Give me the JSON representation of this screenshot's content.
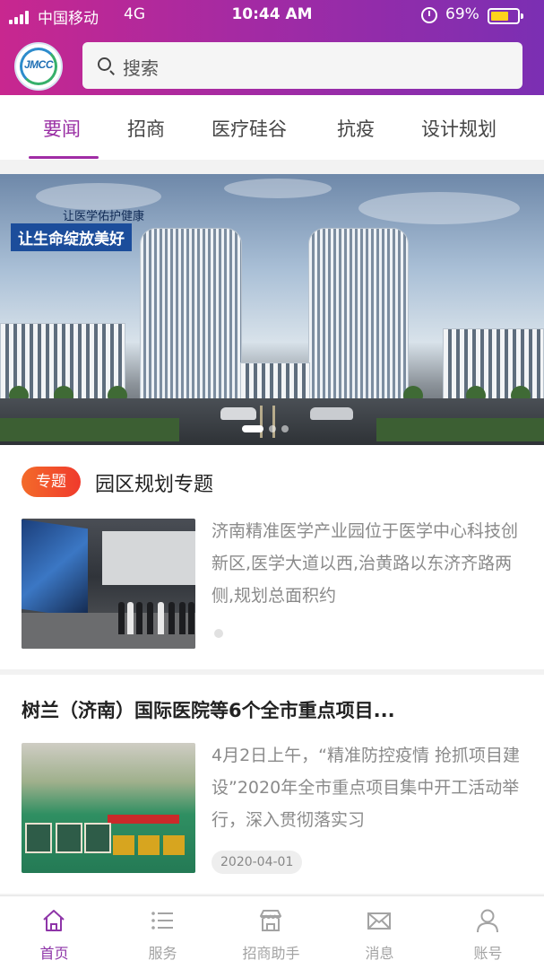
{
  "status_bar": {
    "carrier": "中国移动",
    "network": "4G",
    "time": "10:44 AM",
    "battery_percent": "69%",
    "battery_level": 0.69,
    "battery_color": "#ffd21c"
  },
  "header": {
    "logo_text": "JMCC",
    "search_placeholder": "搜索",
    "gradient_colors": [
      "#c8278f",
      "#7b2fb3"
    ]
  },
  "tabs": [
    {
      "label": "要闻",
      "active": true
    },
    {
      "label": "招商",
      "active": false
    },
    {
      "label": "医疗硅谷",
      "active": false
    },
    {
      "label": "抗疫",
      "active": false
    },
    {
      "label": "设计规划",
      "active": false
    }
  ],
  "banner": {
    "slogan_small": "让医学佑护健康",
    "slogan_big": "让生命绽放美好",
    "slide_count": 3,
    "active_slide": 1
  },
  "topic": {
    "badge": "专题",
    "title": "园区规划专题",
    "description": "济南精准医学产业园位于医学中心科技创新区,医学大道以西,治黄路以东济齐路两侧,规划总面积约"
  },
  "news": {
    "title": "树兰（济南）国际医院等6个全市重点项目...",
    "description": "4月2日上午，“精准防控疫情 抢抓项目建设”2020年全市重点项目集中开工活动举行，深入贯彻落实习",
    "date": "2020-04-01"
  },
  "bottom_nav": [
    {
      "label": "首页",
      "icon": "home-icon",
      "active": true
    },
    {
      "label": "服务",
      "icon": "list-icon",
      "active": false
    },
    {
      "label": "招商助手",
      "icon": "store-icon",
      "active": false
    },
    {
      "label": "消息",
      "icon": "mail-icon",
      "active": false
    },
    {
      "label": "账号",
      "icon": "user-icon",
      "active": false
    }
  ],
  "accent_color": "#9a2fa4"
}
